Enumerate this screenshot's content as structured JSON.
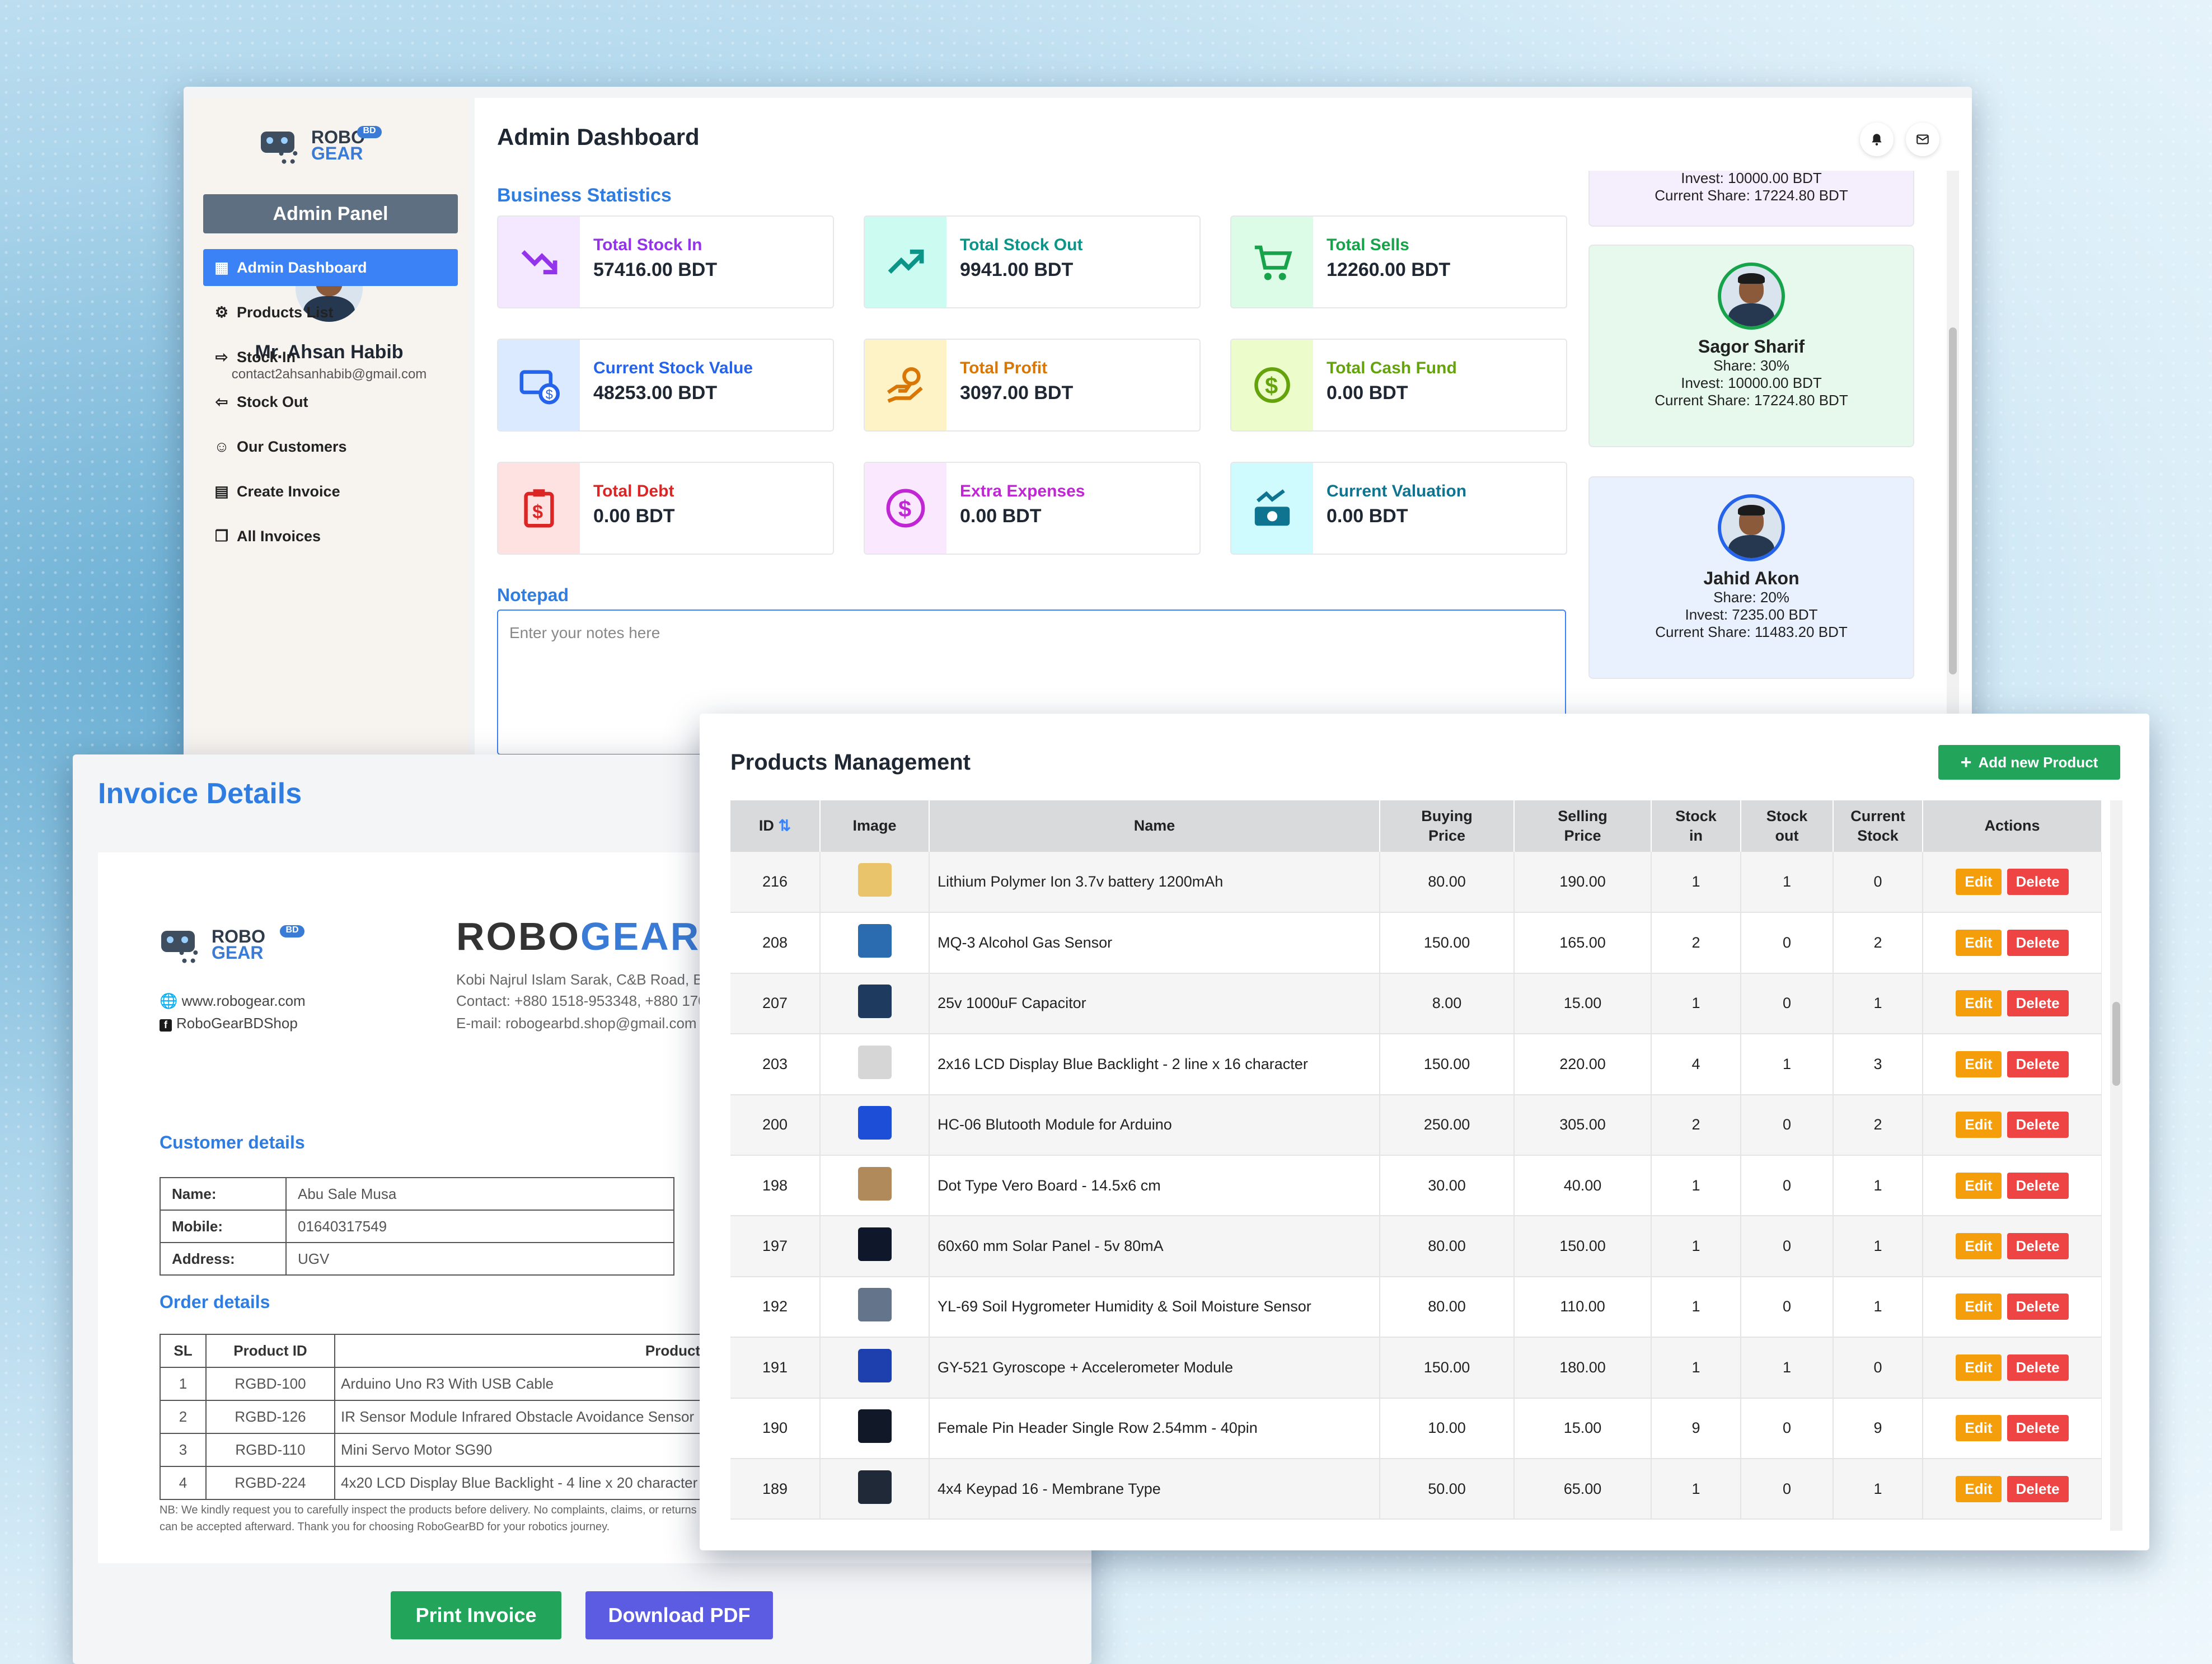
{
  "admin": {
    "brand": {
      "robo": "ROBO",
      "gear": "GEAR",
      "badge": "BD"
    },
    "panel_label": "Admin Panel",
    "user": {
      "name": "Mr. Ahsan Habib",
      "email": "contact2ahsanhabib@gmail.com"
    },
    "nav": [
      {
        "label": "Admin Dashboard",
        "icon": "dashboard-icon",
        "active": true
      },
      {
        "label": "Products List",
        "icon": "boxes-icon"
      },
      {
        "label": "Stock In",
        "icon": "arrow-in-icon"
      },
      {
        "label": "Stock Out",
        "icon": "arrow-out-icon"
      },
      {
        "label": "Our Customers",
        "icon": "users-icon"
      },
      {
        "label": "Create Invoice",
        "icon": "invoice-icon"
      },
      {
        "label": "All Invoices",
        "icon": "invoices-icon"
      }
    ],
    "title": "Admin Dashboard",
    "stats_title": "Business Statistics",
    "stats": [
      {
        "label": "Total Stock In",
        "value": "57416.00 BDT",
        "color": "#9333ea",
        "bg": "#f3e8ff",
        "icon": "trend-down-icon"
      },
      {
        "label": "Total Stock Out",
        "value": "9941.00 BDT",
        "color": "#0d9488",
        "bg": "#ccfbf1",
        "icon": "trend-up-icon"
      },
      {
        "label": "Total Sells",
        "value": "12260.00 BDT",
        "color": "#16a34a",
        "bg": "#dcfce7",
        "icon": "cart-icon"
      },
      {
        "label": "Current Stock Value",
        "value": "48253.00 BDT",
        "color": "#2563eb",
        "bg": "#dbeafe",
        "icon": "money-icon"
      },
      {
        "label": "Total Profit",
        "value": "3097.00 BDT",
        "color": "#d97706",
        "bg": "#fef3c7",
        "icon": "hand-coin-icon"
      },
      {
        "label": "Total Cash Fund",
        "value": "0.00 BDT",
        "color": "#65a30d",
        "bg": "#ecfccb",
        "icon": "coin-cycle-icon"
      },
      {
        "label": "Total Debt",
        "value": "0.00 BDT",
        "color": "#dc2626",
        "bg": "#fee2e2",
        "icon": "clipboard-dollar-icon"
      },
      {
        "label": "Extra Expenses",
        "value": "0.00 BDT",
        "color": "#c026d3",
        "bg": "#fae8ff",
        "icon": "dollar-circle-icon"
      },
      {
        "label": "Current Valuation",
        "value": "0.00 BDT",
        "color": "#0e7490",
        "bg": "#cffafe",
        "icon": "valuation-icon"
      }
    ],
    "notepad_title": "Notepad",
    "notepad_placeholder": "Enter your notes here",
    "partners": [
      {
        "invest": "Invest: 10000.00 BDT",
        "current": "Current Share: 17224.80 BDT",
        "bg": "#f5eefc"
      },
      {
        "name": "Sagor Sharif",
        "share": "Share: 30%",
        "invest": "Invest: 10000.00 BDT",
        "current": "Current Share: 17224.80 BDT",
        "bg": "#e6f9ec",
        "ring": "#16a34a"
      },
      {
        "name": "Jahid Akon",
        "share": "Share: 20%",
        "invest": "Invest: 7235.00 BDT",
        "current": "Current Share: 11483.20 BDT",
        "bg": "#e8f1fd",
        "ring": "#2563eb"
      }
    ]
  },
  "invoice": {
    "title": "Invoice Details",
    "brand_head_a": "ROBO",
    "brand_head_b": "GEARBD",
    "address": "Kobi Najrul Islam Sarak, C&B Road, Barishal.",
    "contact": "Contact: +880 1518-953348, +880 1704-428814",
    "email": "E-mail: robogearbd.shop@gmail.com",
    "website": "www.robogear.com",
    "facebook": "RoboGearBDShop",
    "customer_title": "Customer details",
    "customer": [
      {
        "k": "Name:",
        "v": "Abu Sale Musa"
      },
      {
        "k": "Mobile:",
        "v": "01640317549"
      },
      {
        "k": "Address:",
        "v": "UGV"
      }
    ],
    "order_title": "Order details",
    "order_headers": [
      "SL",
      "Product ID",
      "Product Name"
    ],
    "orders": [
      [
        "1",
        "RGBD-100",
        "Arduino Uno R3 With USB Cable"
      ],
      [
        "2",
        "RGBD-126",
        "IR Sensor Module Infrared Obstacle Avoidance Sensor"
      ],
      [
        "3",
        "RGBD-110",
        "Mini Servo Motor SG90"
      ],
      [
        "4",
        "RGBD-224",
        "4x20 LCD Display Blue Backlight - 4 line x 20 character"
      ]
    ],
    "note": "NB: We kindly request you to carefully inspect the products before delivery. No complaints, claims, or returns can be accepted afterward. Thank you for choosing RoboGearBD for your robotics journey.",
    "print_label": "Print Invoice",
    "download_label": "Download PDF"
  },
  "products": {
    "title": "Products Management",
    "add_label": "Add new Product",
    "headers": [
      "ID",
      "Image",
      "Name",
      "Buying Price",
      "Selling Price",
      "Stock in",
      "Stock out",
      "Current Stock",
      "Actions"
    ],
    "edit_label": "Edit",
    "delete_label": "Delete",
    "rows": [
      {
        "id": "216",
        "name": "Lithium Polymer Ion 3.7v battery 1200mAh",
        "buy": "80.00",
        "sell": "190.00",
        "in": "1",
        "out": "1",
        "cur": "0",
        "img": "#e9c46a"
      },
      {
        "id": "208",
        "name": "MQ-3 Alcohol Gas Sensor",
        "buy": "150.00",
        "sell": "165.00",
        "in": "2",
        "out": "0",
        "cur": "2",
        "img": "#2b6cb0"
      },
      {
        "id": "207",
        "name": "25v 1000uF Capacitor",
        "buy": "8.00",
        "sell": "15.00",
        "in": "1",
        "out": "0",
        "cur": "1",
        "img": "#1e3a5f"
      },
      {
        "id": "203",
        "name": "2x16 LCD Display Blue Backlight - 2 line x 16 character",
        "buy": "150.00",
        "sell": "220.00",
        "in": "4",
        "out": "1",
        "cur": "3",
        "img": "#d6d6d6"
      },
      {
        "id": "200",
        "name": "HC-06 Blutooth Module for Arduino",
        "buy": "250.00",
        "sell": "305.00",
        "in": "2",
        "out": "0",
        "cur": "2",
        "img": "#1d4ed8"
      },
      {
        "id": "198",
        "name": "Dot Type Vero Board - 14.5x6 cm",
        "buy": "30.00",
        "sell": "40.00",
        "in": "1",
        "out": "0",
        "cur": "1",
        "img": "#b08a5a"
      },
      {
        "id": "197",
        "name": "60x60 mm Solar Panel - 5v 80mA",
        "buy": "80.00",
        "sell": "150.00",
        "in": "1",
        "out": "0",
        "cur": "1",
        "img": "#0f172a"
      },
      {
        "id": "192",
        "name": "YL-69 Soil Hygrometer Humidity & Soil Moisture Sensor",
        "buy": "80.00",
        "sell": "110.00",
        "in": "1",
        "out": "0",
        "cur": "1",
        "img": "#64748b"
      },
      {
        "id": "191",
        "name": "GY-521 Gyroscope + Accelerometer Module",
        "buy": "150.00",
        "sell": "180.00",
        "in": "1",
        "out": "1",
        "cur": "0",
        "img": "#1e40af"
      },
      {
        "id": "190",
        "name": "Female Pin Header Single Row 2.54mm - 40pin",
        "buy": "10.00",
        "sell": "15.00",
        "in": "9",
        "out": "0",
        "cur": "9",
        "img": "#111827"
      },
      {
        "id": "189",
        "name": "4x4 Keypad 16 - Membrane Type",
        "buy": "50.00",
        "sell": "65.00",
        "in": "1",
        "out": "0",
        "cur": "1",
        "img": "#1f2937"
      }
    ]
  }
}
